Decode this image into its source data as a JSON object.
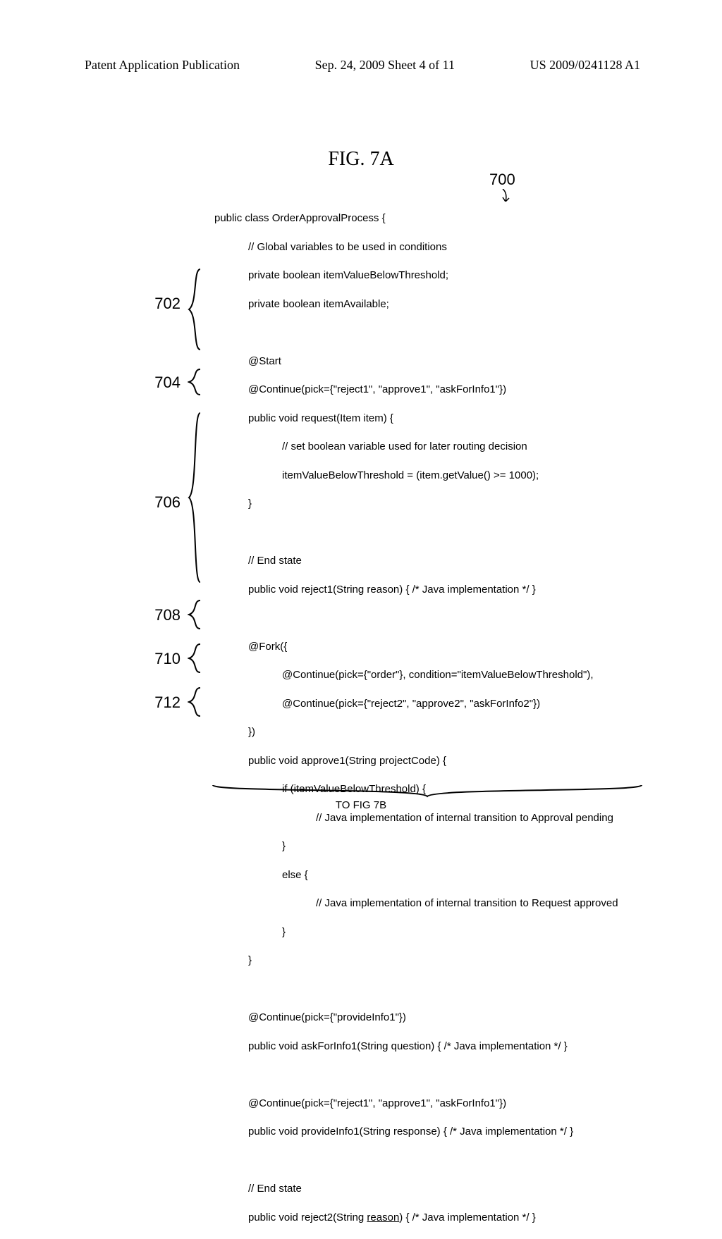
{
  "header": {
    "left": "Patent Application Publication",
    "center": "Sep. 24, 2009  Sheet 4 of 11",
    "right": "US 2009/0241128 A1"
  },
  "figure_title": "FIG. 7A",
  "refs": {
    "r700": "700",
    "r702": "702",
    "r704": "704",
    "r706": "706",
    "r708": "708",
    "r710": "710",
    "r712": "712"
  },
  "code": {
    "l1": "public class OrderApprovalProcess {",
    "l2": "// Global variables to be used in conditions",
    "l3": "private boolean itemValueBelowThreshold;",
    "l4": "private boolean itemAvailable;",
    "l5": "@Start",
    "l6": "@Continue(pick={\"reject1\", \"approve1\", \"askForInfo1\"})",
    "l7": "public void request(Item item) {",
    "l8": "// set boolean variable used for later routing decision",
    "l9": "itemValueBelowThreshold = (item.getValue() >= 1000);",
    "l10": "}",
    "l11": "// End state",
    "l12": "public void reject1(String reason) { /* Java implementation */ }",
    "l13": "@Fork({",
    "l14": "@Continue(pick={\"order\"}, condition=\"itemValueBelowThreshold\"),",
    "l15": "@Continue(pick={\"reject2\", \"approve2\", \"askForInfo2\"})",
    "l16": "})",
    "l17": "public void approve1(String projectCode) {",
    "l18": "if (itemValueBelowThreshold) {",
    "l19": "// Java implementation of internal transition to Approval pending",
    "l20": "}",
    "l21": "else {",
    "l22": "// Java implementation of internal transition to Request approved",
    "l23": "}",
    "l24": "}",
    "l25": "@Continue(pick={\"provideInfo1\"})",
    "l26": "public void askForInfo1(String question) { /* Java implementation */ }",
    "l27": "@Continue(pick={\"reject1\", \"approve1\", \"askForInfo1\"})",
    "l28": "public void provideInfo1(String response) { /* Java implementation */ }",
    "l29": "// End state",
    "l30a": "public void reject2(String ",
    "l30b": "reason",
    "l30c": ") { /* Java implementation */ }"
  },
  "footer": "TO FIG 7B"
}
